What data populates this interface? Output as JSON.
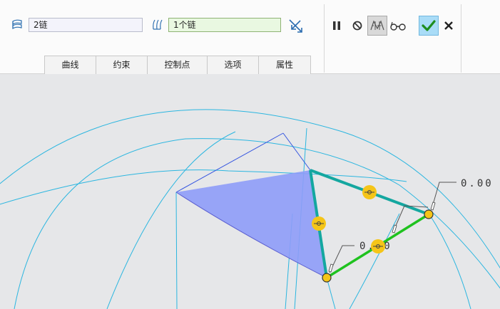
{
  "collectors": {
    "first": {
      "value": "2链",
      "icon": "boundary-surface-icon"
    },
    "second": {
      "value": "1个链",
      "icon": "boundary-surface-icon"
    }
  },
  "tabs": [
    {
      "label": "曲线"
    },
    {
      "label": "约束"
    },
    {
      "label": "控制点"
    },
    {
      "label": "选项"
    },
    {
      "label": "属性"
    }
  ],
  "actions": {
    "pause_icon": "pause-icon",
    "no_preview_icon": "no-preview-icon",
    "preview_icon": "geometry-preview-icon",
    "verify_icon": "glasses-icon",
    "ok_icon": "check-icon",
    "cancel_icon": "close-icon"
  },
  "graphics": {
    "dimension_top": "0.00",
    "dimension_bottom": "0.00",
    "fill_color": "#8e9cf8",
    "chain_color": "#14a7a0",
    "green_color": "#1fc21f",
    "grid_color": "#2bb6e0"
  }
}
